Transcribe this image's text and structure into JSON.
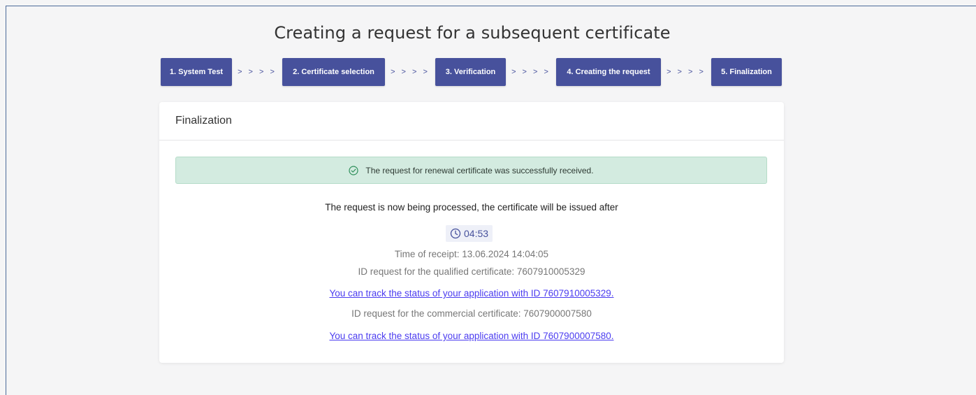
{
  "header": {
    "title": "Creating a request for a subsequent certificate"
  },
  "steps": [
    {
      "label": "1. System Test"
    },
    {
      "label": "2. Certificate selection"
    },
    {
      "label": "3. Verification"
    },
    {
      "label": "4. Creating the request"
    },
    {
      "label": "5. Finalization"
    }
  ],
  "step_separator": "> > > >",
  "card": {
    "title": "Finalization",
    "alert_text": "The request for renewal certificate was successfully received.",
    "processing_text": "The request is now being processed, the certificate will be issued after",
    "timer": "04:53",
    "receipt": "Time of receipt: 13.06.2024 14:04:05",
    "qualified_id": "ID request for the qualified certificate: 7607910005329",
    "qualified_link": "You can track the status of your application with ID 7607910005329.",
    "commercial_id": "ID request for the commercial certificate: 7607900007580",
    "commercial_link": "You can track the status of your application with ID 7607900007580."
  },
  "colors": {
    "accent": "#47519c",
    "success_bg": "#d3ebe0",
    "link": "#4b3cf0"
  }
}
